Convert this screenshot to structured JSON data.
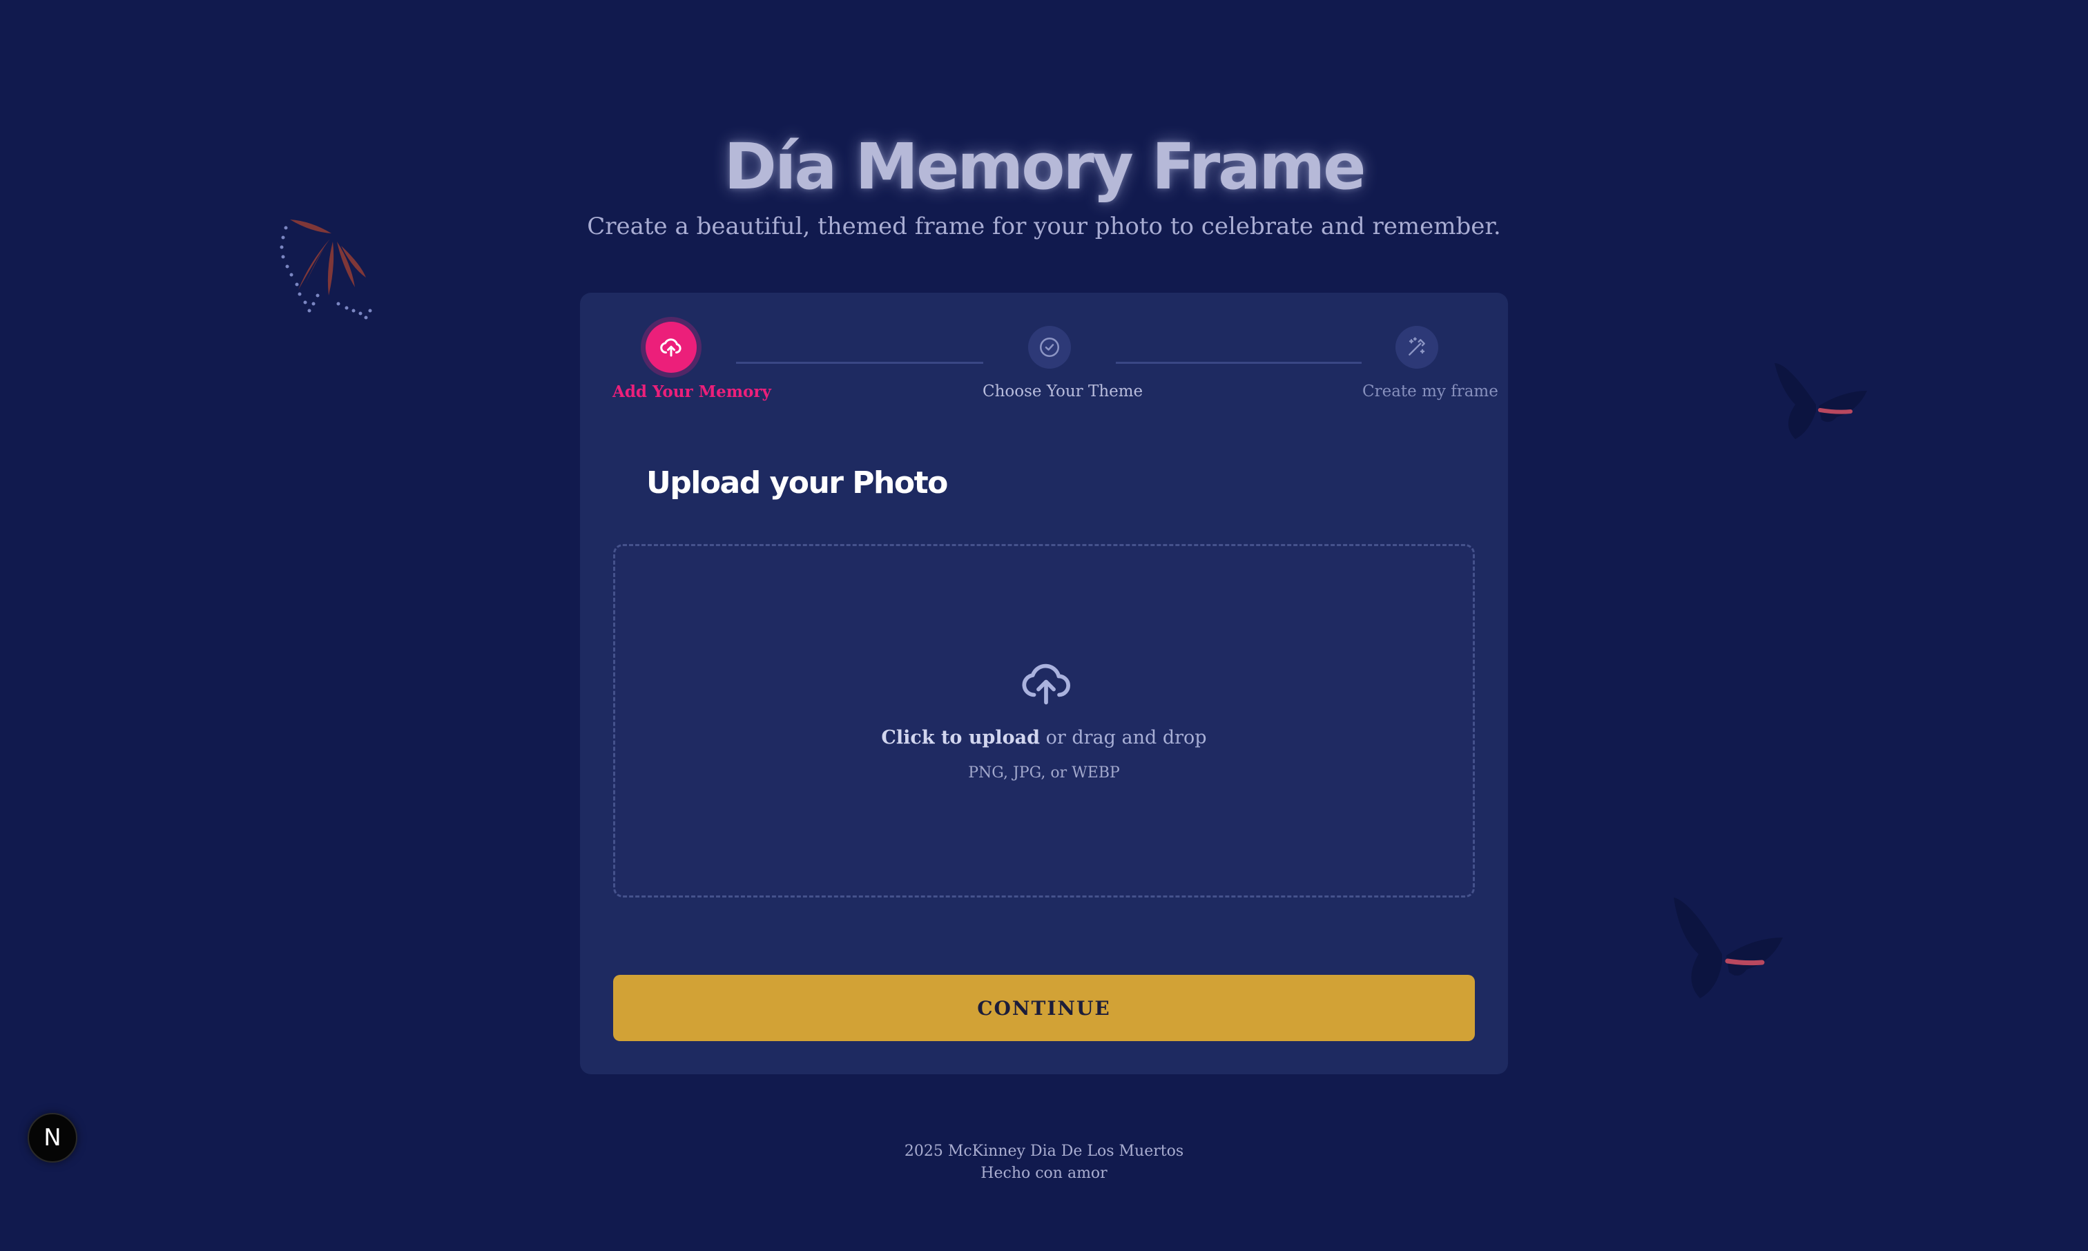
{
  "header": {
    "title": "Día Memory Frame",
    "subtitle": "Create a beautiful, themed frame for your photo to celebrate and remember."
  },
  "stepper": {
    "steps": [
      {
        "label": "Add Your Memory",
        "icon": "cloud-upload-icon",
        "state": "active"
      },
      {
        "label": "Choose Your Theme",
        "icon": "check-circle-icon",
        "state": "upcoming"
      },
      {
        "label": "Create my frame",
        "icon": "magic-wand-icon",
        "state": "upcoming"
      }
    ]
  },
  "upload": {
    "section_title": "Upload your Photo",
    "click_label": "Click to upload",
    "drag_label": "or drag and drop",
    "formats_hint": "PNG, JPG, or WEBP",
    "icon": "cloud-upload-icon"
  },
  "actions": {
    "continue_label": "CONTINUE"
  },
  "footer": {
    "line1": "2025 McKinney Dia De Los Muertos",
    "line2": "Hecho con amor"
  },
  "dev_badge": {
    "label": "N"
  },
  "colors": {
    "background": "#111a4e",
    "card": "#1e2a61",
    "accent_pink": "#ec1f7a",
    "button_gold": "#d2a236"
  }
}
